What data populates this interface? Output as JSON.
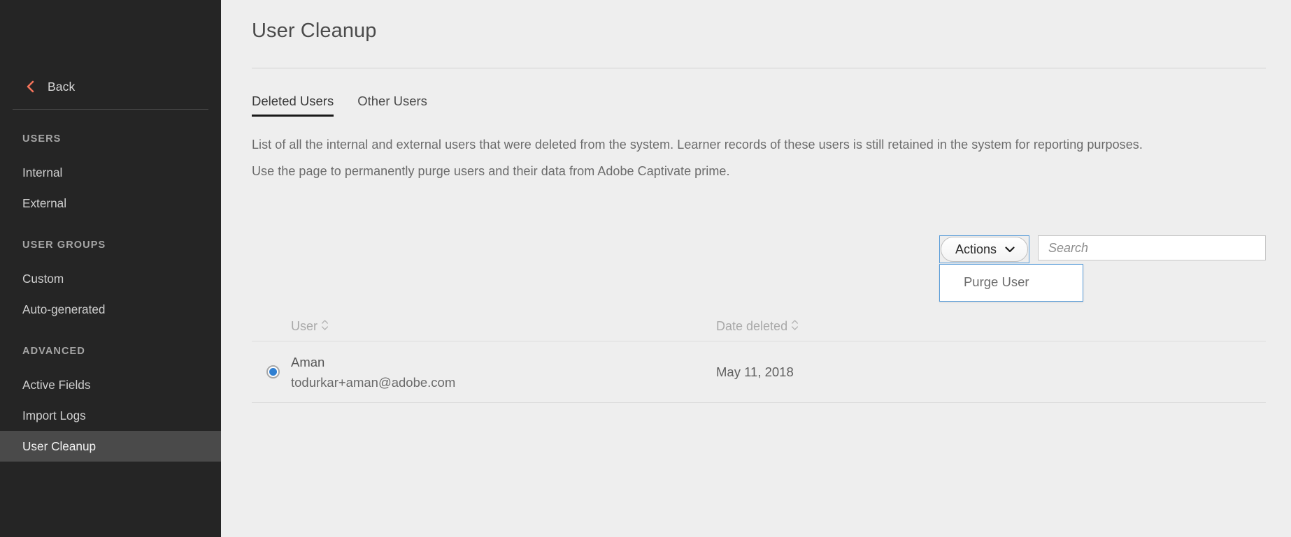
{
  "sidebar": {
    "back": {
      "label": "Back",
      "icon": "chevron-left-icon",
      "color": "#f2735a"
    },
    "sections": [
      {
        "title": "USERS",
        "items": [
          {
            "label": "Internal",
            "active": false
          },
          {
            "label": "External",
            "active": false
          }
        ]
      },
      {
        "title": "USER GROUPS",
        "items": [
          {
            "label": "Custom",
            "active": false
          },
          {
            "label": "Auto-generated",
            "active": false
          }
        ]
      },
      {
        "title": "ADVANCED",
        "items": [
          {
            "label": "Active Fields",
            "active": false
          },
          {
            "label": "Import Logs",
            "active": false
          },
          {
            "label": "User Cleanup",
            "active": true
          }
        ]
      }
    ]
  },
  "main": {
    "title": "User Cleanup",
    "tabs": [
      {
        "label": "Deleted Users",
        "active": true
      },
      {
        "label": "Other Users",
        "active": false
      }
    ],
    "description": [
      "List of all the internal and external users that were deleted from the system. Learner records of these users is still retained in the system for reporting purposes.",
      "Use the page to permanently purge users and their data from Adobe Captivate prime."
    ],
    "toolbar": {
      "actions_label": "Actions",
      "actions_icon": "chevron-down-icon",
      "dropdown_open": true,
      "dropdown_items": [
        "Purge User"
      ],
      "search_placeholder": "Search",
      "search_value": ""
    },
    "table": {
      "columns": [
        {
          "label": "User",
          "sort_icon": "sort-updown-icon"
        },
        {
          "label": "Date deleted",
          "sort_icon": "sort-updown-icon"
        }
      ],
      "rows": [
        {
          "selected": true,
          "name": "Aman",
          "email": "todurkar+aman@adobe.com",
          "date_deleted": "May 11, 2018"
        }
      ]
    }
  },
  "colors": {
    "sidebar_bg": "#252525",
    "sidebar_active_bg": "#4a4a4a",
    "accent_orange": "#f2735a",
    "page_bg": "#eeeeee",
    "focus_blue": "#5b9dd9",
    "radio_blue": "#2f7fd1"
  }
}
